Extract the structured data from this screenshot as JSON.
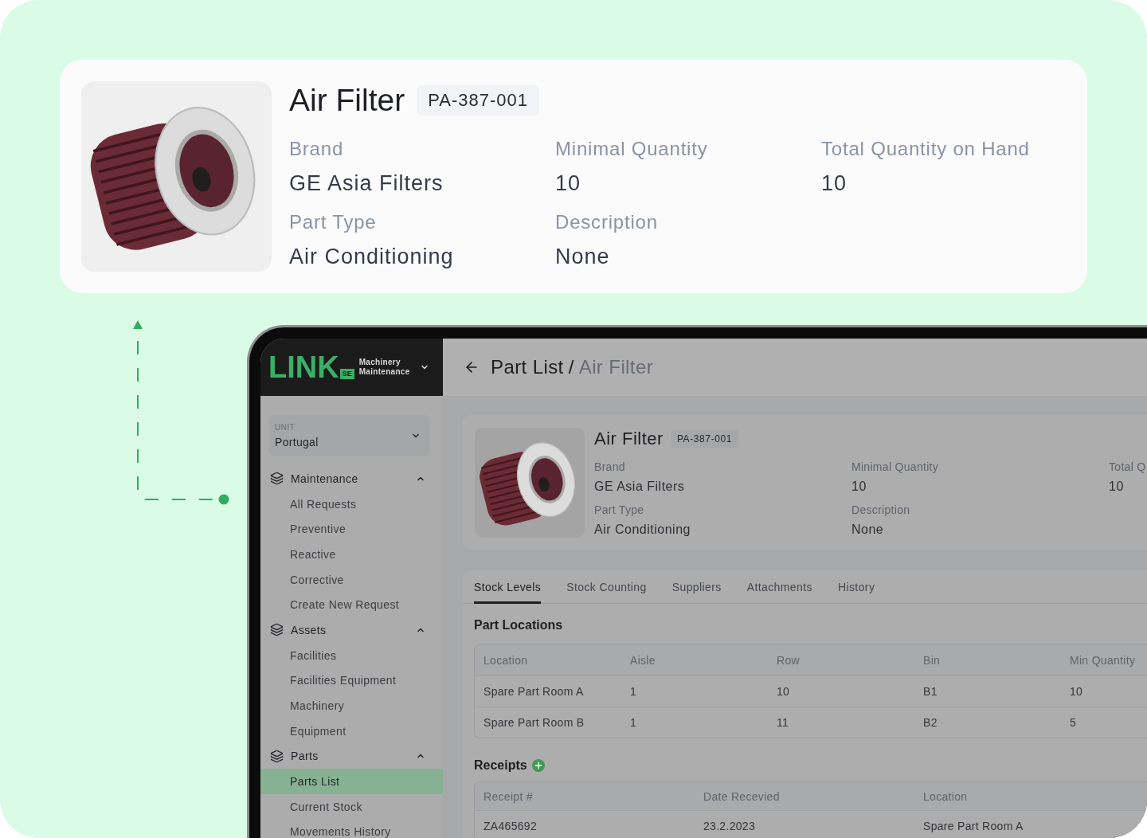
{
  "detail_card": {
    "title": "Air Filter",
    "code": "PA-387-001",
    "fields": [
      {
        "label": "Brand",
        "value": "GE Asia Filters"
      },
      {
        "label": "Minimal Quantity",
        "value": "10"
      },
      {
        "label": "Total Quantity on Hand",
        "value": "10"
      },
      {
        "label": "Part Type",
        "value": "Air Conditioning"
      },
      {
        "label": "Description",
        "value": "None"
      }
    ]
  },
  "app": {
    "sidebar": {
      "logo": {
        "wordmark": "LINK",
        "badge": "SE"
      },
      "workspace": "Machinery Maintenance",
      "unit": {
        "label": "UNIT",
        "value": "Portugal"
      },
      "nav": [
        {
          "label": "Maintenance",
          "expanded": true,
          "children": [
            {
              "label": "All Requests",
              "selected": false
            },
            {
              "label": "Preventive",
              "selected": false
            },
            {
              "label": "Reactive",
              "selected": false
            },
            {
              "label": "Corrective",
              "selected": false
            },
            {
              "label": "Create New Request",
              "selected": false
            }
          ]
        },
        {
          "label": "Assets",
          "expanded": true,
          "children": [
            {
              "label": "Facilities",
              "selected": false
            },
            {
              "label": "Facilities Equipment",
              "selected": false
            },
            {
              "label": "Machinery",
              "selected": false
            },
            {
              "label": "Equipment",
              "selected": false
            }
          ]
        },
        {
          "label": "Parts",
          "expanded": true,
          "children": [
            {
              "label": "Parts List",
              "selected": true
            },
            {
              "label": "Current Stock",
              "selected": false
            },
            {
              "label": "Movements History",
              "selected": false
            }
          ]
        }
      ]
    },
    "header": {
      "parent": "Part List",
      "separator": "/",
      "current": "Air Filter"
    },
    "part_card": {
      "title": "Air Filter",
      "code": "PA-387-001",
      "fields": [
        {
          "label": "Brand",
          "value": "GE Asia Filters"
        },
        {
          "label": "Minimal Quantity",
          "value": "10"
        },
        {
          "label": "Total Q",
          "value": "10"
        },
        {
          "label": "Part Type",
          "value": "Air Conditioning"
        },
        {
          "label": "Description",
          "value": "None"
        }
      ]
    },
    "tabs": [
      {
        "label": "Stock Levels",
        "selected": true
      },
      {
        "label": "Stock Counting",
        "selected": false
      },
      {
        "label": "Suppliers",
        "selected": false
      },
      {
        "label": "Attachments",
        "selected": false
      },
      {
        "label": "History",
        "selected": false
      }
    ],
    "part_locations": {
      "title": "Part Locations",
      "columns": [
        "Location",
        "Aisle",
        "Row",
        "Bin",
        "Min Quantity"
      ],
      "rows": [
        [
          "Spare Part Room A",
          "1",
          "10",
          "B1",
          "10"
        ],
        [
          "Spare Part Room B",
          "1",
          "11",
          "B2",
          "5"
        ]
      ]
    },
    "receipts": {
      "title": "Receipts",
      "columns": [
        "Receipt #",
        "Date Recevied",
        "Location"
      ],
      "rows": [
        [
          "ZA465692",
          "23.2.2023",
          "Spare Part Room A"
        ]
      ]
    }
  }
}
